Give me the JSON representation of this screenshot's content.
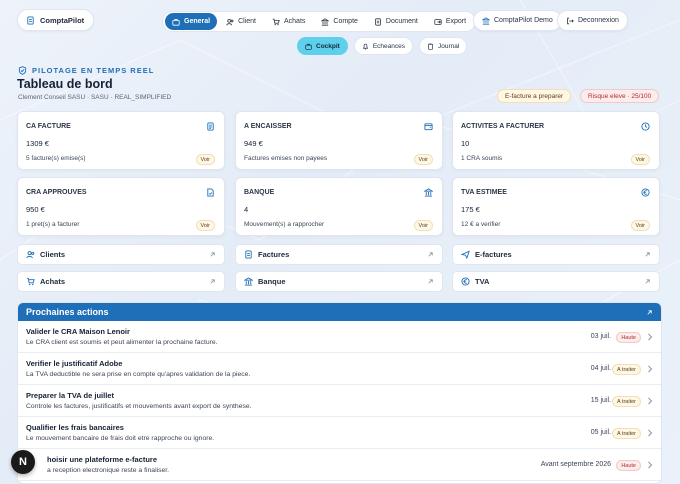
{
  "brand": {
    "name": "ComptaPilot"
  },
  "main_nav": [
    {
      "label": "General",
      "icon": "briefcase-icon",
      "active": true
    },
    {
      "label": "Client",
      "icon": "users-icon",
      "active": false
    },
    {
      "label": "Achats",
      "icon": "cart-icon",
      "active": false
    },
    {
      "label": "Compte",
      "icon": "bank-icon",
      "active": false
    },
    {
      "label": "Document",
      "icon": "document-icon",
      "active": false
    },
    {
      "label": "Export",
      "icon": "export-icon",
      "active": false
    }
  ],
  "header_buttons": {
    "demo": "ComptaPilot Demo",
    "logout": "Deconnexion"
  },
  "sub_nav": [
    {
      "label": "Cockpit",
      "icon": "briefcase-icon",
      "active": true
    },
    {
      "label": "Echeances",
      "icon": "bell-icon",
      "active": false
    },
    {
      "label": "Journal",
      "icon": "clipboard-icon",
      "active": false
    }
  ],
  "header": {
    "eyebrow": "PILOTAGE EN TEMPS REEL",
    "title": "Tableau de bord",
    "subtitle": "Clement Conseil SASU · SASU · REAL_SIMPLIFIED",
    "badges": [
      "E-facture a preparer",
      "Risque eleve · 25/100"
    ]
  },
  "kpis": [
    {
      "title": "CA FACTURE",
      "value": "1309 €",
      "desc": "5 facture(s) emise(s)",
      "action": "Voir",
      "icon": "invoice-icon"
    },
    {
      "title": "A ENCAISSER",
      "value": "949 €",
      "desc": "Factures emises non payees",
      "action": "Voir",
      "icon": "wallet-icon"
    },
    {
      "title": "ACTIVITES A FACTURER",
      "value": "10",
      "desc": "1 CRA soumis",
      "action": "Voir",
      "icon": "clock-icon"
    },
    {
      "title": "CRA APPROUVES",
      "value": "950 €",
      "desc": "1 pret(s) a facturer",
      "action": "Voir",
      "icon": "file-check-icon"
    },
    {
      "title": "BANQUE",
      "value": "4",
      "desc": "Mouvement(s) a rapprocher",
      "action": "Voir",
      "icon": "bank-icon"
    },
    {
      "title": "TVA ESTIMEE",
      "value": "175 €",
      "desc": "12 € a verifier",
      "action": "Voir",
      "icon": "euro-icon"
    }
  ],
  "quick_links": [
    {
      "label": "Clients",
      "icon": "users-icon"
    },
    {
      "label": "Factures",
      "icon": "document-icon"
    },
    {
      "label": "E-factures",
      "icon": "send-icon"
    },
    {
      "label": "Achats",
      "icon": "cart-icon"
    },
    {
      "label": "Banque",
      "icon": "bank-icon"
    },
    {
      "label": "TVA",
      "icon": "euro-icon"
    }
  ],
  "actions": {
    "title": "Prochaines actions",
    "items": [
      {
        "title": "Valider le CRA Maison Lenoir",
        "desc": "Le CRA client est soumis et peut alimenter la prochaine facture.",
        "date": "03 juil.",
        "priority": "Haute"
      },
      {
        "title": "Verifier le justificatif Adobe",
        "desc": "La TVA deductible ne sera prise en compte qu'apres validation de la piece.",
        "date": "04 juil.",
        "priority": "A traiter"
      },
      {
        "title": "Preparer la TVA de juillet",
        "desc": "Controle les factures, justificatifs et mouvements avant export de synthese.",
        "date": "15 juil.",
        "priority": "A traiter"
      },
      {
        "title": "Qualifier les frais bancaires",
        "desc": "Le mouvement bancaire de frais doit etre rapproche ou ignore.",
        "date": "05 juil.",
        "priority": "A traiter"
      },
      {
        "title": "hoisir une plateforme e-facture",
        "desc": "a reception electronique reste a finaliser.",
        "date": "Avant septembre 2026",
        "priority": "Haute"
      }
    ]
  },
  "fab": {
    "label": "N"
  },
  "colors": {
    "primary": "#1f6fb8",
    "accent": "#5fd0ec",
    "danger": "#b42a2a"
  }
}
